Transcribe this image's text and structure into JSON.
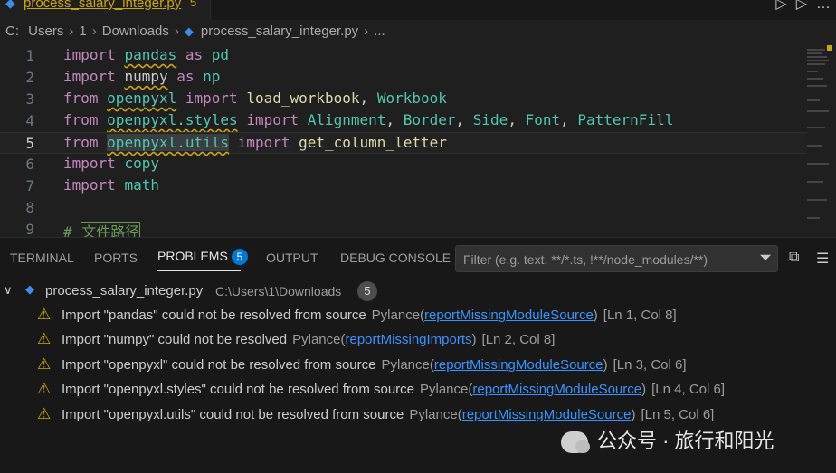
{
  "tab": {
    "filename": "process_salary_integer.py",
    "count": "5"
  },
  "tab_actions": [
    "▷",
    "▷",
    "…"
  ],
  "breadcrumb": {
    "items": [
      "C:",
      "Users",
      "1",
      "Downloads",
      "process_salary_integer.py",
      "..."
    ]
  },
  "editor": {
    "lines": [
      {
        "num": "1"
      },
      {
        "num": "2"
      },
      {
        "num": "3"
      },
      {
        "num": "4"
      },
      {
        "num": "5"
      },
      {
        "num": "6"
      },
      {
        "num": "7"
      },
      {
        "num": "8"
      },
      {
        "num": "9"
      }
    ],
    "tokens": {
      "import": "import",
      "from": "from",
      "as": "as",
      "pandas": "pandas",
      "pd": "pd",
      "numpy": "numpy",
      "np": "np",
      "openpyxl": "openpyxl",
      "load_workbook": "load_workbook",
      "Workbook": "Workbook",
      "openpyxl_styles": "openpyxl.styles",
      "Alignment": "Alignment",
      "Border": "Border",
      "Side": "Side",
      "Font": "Font",
      "PatternFill": "PatternFill",
      "openpyxl_utils": "openpyxl.utils",
      "get_column_letter": "get_column_letter",
      "copy": "copy",
      "math": "math",
      "comment": "# ",
      "comment_text": "文件路径",
      "comma": ", "
    }
  },
  "panel": {
    "tabs": [
      "TERMINAL",
      "PORTS",
      "PROBLEMS",
      "OUTPUT",
      "DEBUG CONSOLE"
    ],
    "problems_count": "5",
    "filter_placeholder": "Filter (e.g. text, **/*.ts, !**/node_modules/**)",
    "file": {
      "name": "process_salary_integer.py",
      "path": "C:\\Users\\1\\Downloads",
      "count": "5"
    },
    "problems": [
      {
        "message": "Import \"pandas\" could not be resolved from source",
        "source": "Pylance(",
        "code": "reportMissingModuleSource",
        "close": ")",
        "position": "[Ln 1, Col 8]"
      },
      {
        "message": "Import \"numpy\" could not be resolved",
        "source": "Pylance(",
        "code": "reportMissingImports",
        "close": ")",
        "position": "[Ln 2, Col 8]"
      },
      {
        "message": "Import \"openpyxl\" could not be resolved from source",
        "source": "Pylance(",
        "code": "reportMissingModuleSource",
        "close": ")",
        "position": "[Ln 3, Col 6]"
      },
      {
        "message": "Import \"openpyxl.styles\" could not be resolved from source",
        "source": "Pylance(",
        "code": "reportMissingModuleSource",
        "close": ")",
        "position": "[Ln 4, Col 6]"
      },
      {
        "message": "Import \"openpyxl.utils\" could not be resolved from source",
        "source": "Pylance(",
        "code": "reportMissingModuleSource",
        "close": ")",
        "position": "[Ln 5, Col 6]"
      }
    ]
  },
  "watermark": {
    "text": "公众号 · 旅行和阳光"
  },
  "colors": {
    "warning": "#cca700",
    "accent": "#0078d4",
    "link": "#3794ff"
  }
}
